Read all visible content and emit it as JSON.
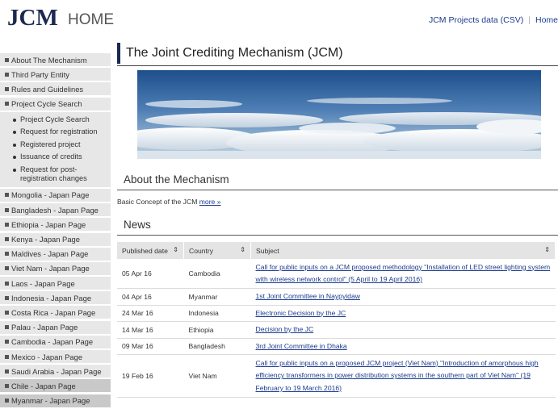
{
  "header": {
    "logo": "JCM",
    "home": "HOME",
    "links": [
      "JCM Projects data (CSV)",
      "Home"
    ]
  },
  "sidebar": {
    "items": [
      {
        "label": "About The Mechanism"
      },
      {
        "label": "Third Party Entity"
      },
      {
        "label": "Rules and Guidelines"
      },
      {
        "label": "Project Cycle Search"
      }
    ],
    "sub_items": [
      "Project Cycle Search",
      "Request for registration",
      "Registered project",
      "Issuance of credits",
      "Request for post-registration changes"
    ],
    "countries": [
      "Mongolia - Japan Page",
      "Bangladesh - Japan Page",
      "Ethiopia - Japan Page",
      "Kenya - Japan Page",
      "Maldives - Japan Page",
      "Viet Nam - Japan Page",
      "Laos - Japan Page",
      "Indonesia - Japan Page",
      "Costa Rica - Japan Page",
      "Palau - Japan Page",
      "Cambodia - Japan Page",
      "Mexico - Japan Page",
      "Saudi Arabia - Japan Page",
      "Chile - Japan Page",
      "Myanmar - Japan Page"
    ]
  },
  "main": {
    "title": "The Joint Crediting Mechanism (JCM)",
    "about_heading": "About the Mechanism",
    "basic_text": "Basic Concept of the JCM ",
    "more_link": "more »",
    "news_heading": "News",
    "table": {
      "headers": [
        "Published date",
        "Country",
        "Subject"
      ],
      "sort_glyph": "⇕",
      "rows": [
        {
          "date": "05 Apr 16",
          "country": "Cambodia",
          "subject": "Call for public inputs on a JCM proposed methodology \"Installation of LED street lighting system with wireless network control\" (5 April to 19 April 2016)"
        },
        {
          "date": "04 Apr 16",
          "country": "Myanmar",
          "subject": "1st Joint Committee in Naypyidaw"
        },
        {
          "date": "24 Mar 16",
          "country": "Indonesia",
          "subject": "Electronic Decision by the JC"
        },
        {
          "date": "14 Mar 16",
          "country": "Ethiopia",
          "subject": "Decision by the JC"
        },
        {
          "date": "09 Mar 16",
          "country": "Bangladesh",
          "subject": "3rd Joint Committee in Dhaka"
        },
        {
          "date": "19 Feb 16",
          "country": "Viet Nam",
          "subject": "Call for public inputs on a proposed JCM project (Viet Nam) \"Introduction of amorphous high efficiency transformers in power distribution systems in the southern part of Viet Nam\" (19 February to 19 March 2016)"
        }
      ]
    }
  },
  "colors": {
    "logo": "#1a2a50",
    "link": "#1b3b8c",
    "sidebar_bg": "#e7e7e7",
    "sidebar_active": "#c9c9c9"
  }
}
